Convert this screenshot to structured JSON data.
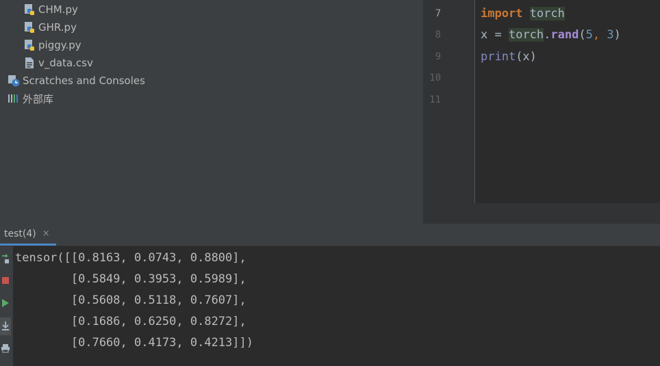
{
  "project_tree": {
    "items": [
      {
        "label": "CHM.py",
        "icon": "python-file-icon"
      },
      {
        "label": "GHR.py",
        "icon": "python-file-icon"
      },
      {
        "label": "piggy.py",
        "icon": "python-file-icon"
      },
      {
        "label": "v_data.csv",
        "icon": "text-file-icon"
      },
      {
        "label": "Scratches and Consoles",
        "icon": "scratches-icon"
      },
      {
        "label": "外部库",
        "icon": "library-icon"
      }
    ]
  },
  "editor": {
    "line_numbers": [
      "7",
      "8",
      "9",
      "10",
      "11"
    ],
    "code": {
      "line7": {
        "keyword": "import",
        "module": "torch"
      },
      "line8": {
        "var": "x",
        "eq": " = ",
        "module": "torch",
        "dot": ".",
        "method": "rand",
        "open": "(",
        "arg1": "5",
        "comma": ", ",
        "arg2": "3",
        "close": ")"
      },
      "line9": {
        "builtin": "print",
        "args": "(x)"
      }
    }
  },
  "run": {
    "tab_label": "test(4)",
    "close_symbol": "×",
    "output_lines": [
      "tensor([[0.8163, 0.0743, 0.8800],",
      "        [0.5849, 0.3953, 0.5989],",
      "        [0.5608, 0.5118, 0.7607],",
      "        [0.1686, 0.6250, 0.8272],",
      "        [0.7660, 0.4173, 0.4213]])"
    ]
  },
  "colors": {
    "keyword": "#cc7832",
    "number": "#6897bb",
    "stop_red": "#c75450",
    "run_green": "#59a869",
    "tab_underline": "#4a88c7"
  }
}
